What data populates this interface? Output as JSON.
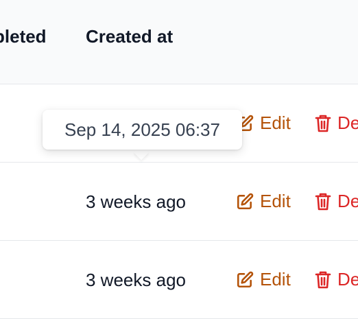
{
  "table": {
    "columns": {
      "completed": "pleted",
      "created_at": "Created at"
    },
    "rows": [
      {
        "created_at": "",
        "edit_label": "Edit",
        "delete_label": "De"
      },
      {
        "created_at": "3 weeks ago",
        "edit_label": "Edit",
        "delete_label": "De"
      },
      {
        "created_at": "3 weeks ago",
        "edit_label": "Edit",
        "delete_label": "De"
      }
    ]
  },
  "tooltip": {
    "text": "Sep 14, 2025 06:37"
  },
  "icons": {
    "edit": "edit-icon",
    "delete": "trash-icon"
  },
  "colors": {
    "edit": "#b45309",
    "delete": "#dc2626",
    "header_bg": "#f9fafb",
    "border": "#e5e7eb"
  }
}
